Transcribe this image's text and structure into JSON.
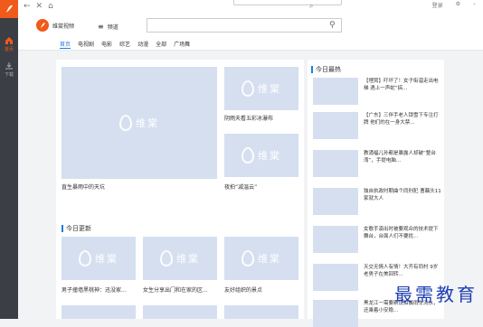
{
  "titlebar": {
    "right": [
      "登录",
      "",
      ""
    ]
  },
  "brand": {
    "name": "维棠视频"
  },
  "channel": {
    "label": "频道"
  },
  "nav": {
    "tabs": [
      "首页",
      "电视剧",
      "电影",
      "综艺",
      "动漫",
      "全部",
      "广场舞"
    ],
    "active": 0
  },
  "sidebar": {
    "home": "首页",
    "download": "下载"
  },
  "featured": {
    "main_caption": "直生暴雨中的天坑",
    "side": [
      {
        "caption": "阴雨天看五彩冰瀑布"
      },
      {
        "caption": "夜拍“减温云”"
      }
    ]
  },
  "watermark_text": {
    "cn": "维棠",
    "en": "ViDown"
  },
  "today_update": {
    "title": "今日更新",
    "items": [
      {
        "caption": "男子撞墙黑桃神：迅没家..."
      },
      {
        "caption": "女生分享出门和在家的区..."
      },
      {
        "caption": "友好组织的景点"
      }
    ]
  },
  "today_hot": {
    "title": "今日最热",
    "items": [
      {
        "text": "【埋窝】吓坏了！女子街溜走出电梯 遇上一声蛇“搞..."
      },
      {
        "text": "【广东】三伴手老人锁雪下专注打牌 他们的在一身大禁..."
      },
      {
        "text": "教涌福儿孙都是暴露人却破“整台湾”，手提电脑..."
      },
      {
        "text": "独自执政时期曲个同刑犯 曹藕头11家就大人"
      },
      {
        "text": "女歌手演出时被要观众的技术提下舞台，台面人们不要扰..."
      },
      {
        "text": "天交无情人有情！大齐有同村 9岁老男子在美回转..."
      },
      {
        "text": "黑龙江一需要新设拍摄雨车流水，还乘着小安稳..."
      }
    ]
  },
  "overlay_watermark": "最需教育"
}
